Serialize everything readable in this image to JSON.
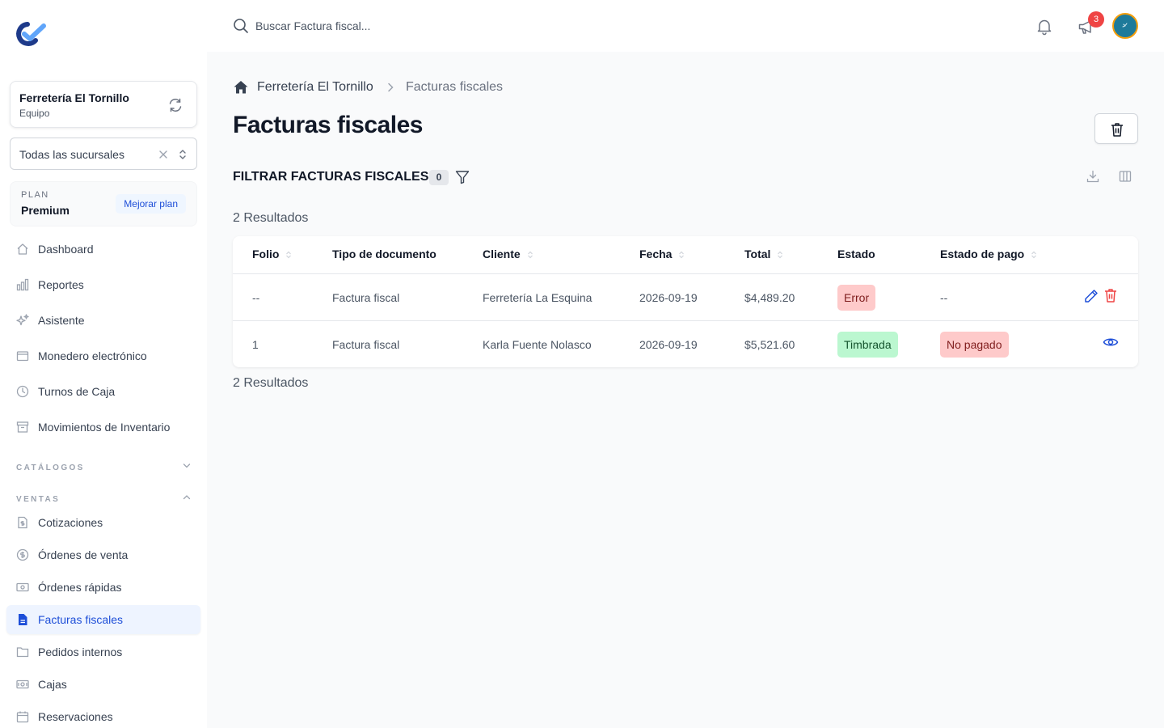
{
  "sidebar": {
    "team": {
      "name": "Ferretería El Tornillo",
      "subtitle": "Equipo"
    },
    "branch": {
      "value": "Todas las sucursales"
    },
    "plan": {
      "label": "PLAN",
      "value": "Premium",
      "upgrade": "Mejorar plan"
    },
    "items": [
      {
        "label": "Dashboard",
        "icon": "home-icon"
      },
      {
        "label": "Reportes",
        "icon": "chart-icon"
      },
      {
        "label": "Asistente",
        "icon": "sparkles-icon"
      },
      {
        "label": "Monedero electrónico",
        "icon": "wallet-icon"
      },
      {
        "label": "Turnos de Caja",
        "icon": "clock-icon"
      },
      {
        "label": "Movimientos de Inventario",
        "icon": "archive-icon"
      }
    ],
    "sections": [
      {
        "label": "CATÁLOGOS",
        "expanded": false
      },
      {
        "label": "VENTAS",
        "expanded": true
      }
    ],
    "ventas_items": [
      {
        "label": "Cotizaciones",
        "icon": "document-dollar-icon"
      },
      {
        "label": "Órdenes de venta",
        "icon": "currency-circle-icon"
      },
      {
        "label": "Órdenes rápidas",
        "icon": "banknote-icon"
      },
      {
        "label": "Facturas fiscales",
        "icon": "document-text-icon",
        "active": true
      },
      {
        "label": "Pedidos internos",
        "icon": "folder-icon"
      },
      {
        "label": "Cajas",
        "icon": "cash-register-icon"
      },
      {
        "label": "Reservaciones",
        "icon": "calendar-icon"
      }
    ]
  },
  "topbar": {
    "search_placeholder": "Buscar Factura fiscal...",
    "notifications_count": "3"
  },
  "breadcrumb": {
    "root": "Ferretería El Tornillo",
    "current": "Facturas fiscales"
  },
  "page": {
    "title": "Facturas fiscales",
    "filter_title": "FILTRAR FACTURAS FISCALES",
    "filter_count": "0",
    "results_top": "2 Resultados",
    "results_bottom": "2 Resultados"
  },
  "table": {
    "headers": [
      "Folio",
      "Tipo de documento",
      "Cliente",
      "Fecha",
      "Total",
      "Estado",
      "Estado de pago"
    ],
    "rows": [
      {
        "folio": "--",
        "tipo": "Factura fiscal",
        "cliente": "Ferretería La Esquina",
        "fecha": "2026-09-19",
        "total": "$4,489.20",
        "estado": "Error",
        "pago": "--"
      },
      {
        "folio": "1",
        "tipo": "Factura fiscal",
        "cliente": "Karla Fuente Nolasco",
        "fecha": "2026-09-19",
        "total": "$5,521.60",
        "estado": "Timbrada",
        "pago": "No pagado"
      }
    ]
  },
  "colors": {
    "accent": "#1d4ed8",
    "error_bg": "#fecaca",
    "success_bg": "#bbf7d0",
    "badge": "#ef4444"
  }
}
